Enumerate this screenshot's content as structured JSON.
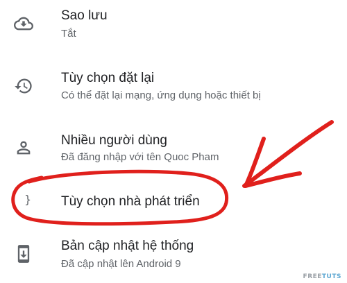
{
  "settings": {
    "items": [
      {
        "icon": "cloud-upload-icon",
        "title": "Sao lưu",
        "subtitle": "Tắt"
      },
      {
        "icon": "history-icon",
        "title": "Tùy chọn đặt lại",
        "subtitle": "Có thể đặt lại mạng, ứng dụng hoặc thiết bị"
      },
      {
        "icon": "person-icon",
        "title": "Nhiều người dùng",
        "subtitle": "Đã đăng nhập với tên Quoc Pham"
      },
      {
        "icon": "developer-options-icon",
        "title": "Tùy chọn nhà phát triển",
        "subtitle": "",
        "highlighted": true
      },
      {
        "icon": "system-update-icon",
        "title": "Bản cập nhật hệ thống",
        "subtitle": "Đã cập nhật lên Android 9"
      }
    ]
  },
  "annotation": {
    "color": "#e0201c",
    "shapes": [
      "circle-around-developer-options",
      "arrow-pointing-left"
    ]
  },
  "watermark": {
    "text_part1": "FREE",
    "text_part2": "TUTS"
  },
  "colors": {
    "title": "#202124",
    "subtitle": "#5f6368",
    "icon": "#5f6368"
  }
}
